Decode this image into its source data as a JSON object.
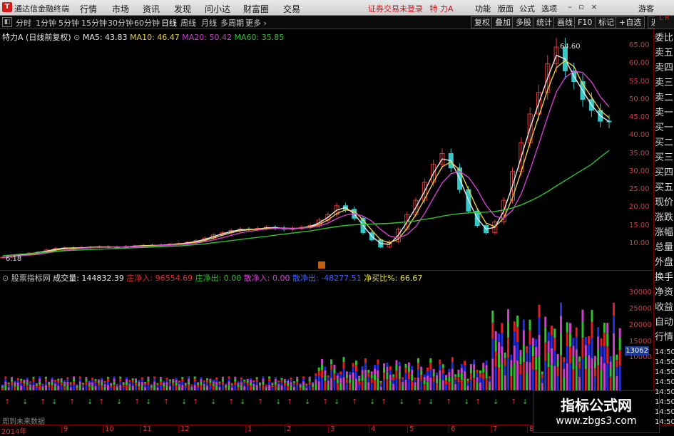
{
  "app": {
    "title": "通达信金融终端",
    "status": "证券交易未登录",
    "stock_short": "特 力A"
  },
  "menu": [
    "行情",
    "市场",
    "资讯",
    "发现",
    "问小达",
    "财富圈",
    "交易"
  ],
  "right_menu": [
    "功能",
    "版面",
    "公式",
    "选项",
    "游客"
  ],
  "periods": [
    "分时",
    "1分钟",
    "5分钟",
    "15分钟",
    "30分钟",
    "60分钟",
    "日线",
    "周线",
    "月线",
    "多周期",
    "更多"
  ],
  "active_period": "日线",
  "tool_buttons": [
    "复权",
    "叠加",
    "多股",
    "统计",
    "画线",
    "F10",
    "标记",
    "+自选",
    "返回"
  ],
  "chart_header": {
    "name": "特力A",
    "adjust": "(日线前复权)"
  },
  "ma_legend": [
    {
      "label": "MA5: 43.83",
      "color": "#e8e8e8"
    },
    {
      "label": "MA10: 46.47",
      "color": "#e8d040"
    },
    {
      "label": "MA20: 50.42",
      "color": "#d040d0"
    },
    {
      "label": "MA60: 35.85",
      "color": "#30c030"
    }
  ],
  "vol_legend": [
    {
      "label": "股票指标网",
      "color": "#c8c8c8"
    },
    {
      "label": "成交量: 144832.39",
      "color": "#e8e8e8"
    },
    {
      "label": "庄净入: 96554.69",
      "color": "#e03030"
    },
    {
      "label": "庄净出: 0.00",
      "color": "#30c030"
    },
    {
      "label": "散净入: 0.00",
      "color": "#d040d0"
    },
    {
      "label": "散净出: -48277.51",
      "color": "#4060ff"
    },
    {
      "label": "净买比%: 66.67",
      "color": "#e8e040"
    }
  ],
  "price_annotations": {
    "high": "64.60",
    "low": "6.18"
  },
  "price_axis": [
    "65.00",
    "60.00",
    "55.00",
    "50.00",
    "45.00",
    "40.00",
    "35.00",
    "30.00",
    "25.00",
    "20.00",
    "15.00",
    "10.00"
  ],
  "vol_axis": [
    "30000",
    "25000",
    "20000",
    "15000",
    "10000"
  ],
  "vol_marker": "13062",
  "side_tabs": [
    "委比",
    "卖五",
    "卖四",
    "卖三",
    "卖二",
    "卖一",
    "买一",
    "买二",
    "买三",
    "买四",
    "买五",
    "现价",
    "涨跌",
    "涨幅",
    "总量",
    "外盘",
    "换手",
    "净资",
    "收益",
    "自动",
    "行情"
  ],
  "side_times": [
    "14:50",
    "14:50",
    "14:50",
    "14:50",
    "14:50",
    "14:50",
    "14:50",
    "14:50"
  ],
  "footer": {
    "note": "周到未来数据",
    "year": "2014年"
  },
  "months": [
    "9",
    "10",
    "11",
    "12",
    "1",
    "2",
    "3",
    "4",
    "5",
    "6",
    "7",
    "8"
  ],
  "watermark": {
    "line1": "指标公式网",
    "line2": "www.zbgs3.com"
  },
  "chart_data": {
    "type": "line",
    "title": "特力A",
    "ylim": [
      5,
      66
    ],
    "close": [
      6.2,
      6.6,
      7.0,
      7.3,
      7.6,
      8.2,
      8.6,
      8.8,
      8.7,
      8.9,
      9.0,
      9.1,
      9.0,
      8.9,
      9.2,
      9.3,
      9.5,
      9.4,
      9.6,
      9.8,
      10.0,
      10.3,
      10.8,
      11.5,
      12.4,
      13.0,
      13.6,
      14.0,
      13.8,
      14.2,
      14.5,
      14.3,
      14.0,
      14.2,
      14.5,
      15.0,
      16.5,
      18.0,
      20.5,
      19.5,
      17.0,
      13.0,
      11.0,
      9.0,
      10.5,
      14.0,
      18.0,
      22.0,
      27.0,
      32.0,
      35.0,
      31.0,
      25.0,
      19.0,
      15.0,
      13.0,
      16.0,
      22.0,
      30.0,
      38.0,
      46.0,
      52.0,
      60.0,
      64.6,
      58.0,
      55.0,
      50.0,
      47.0,
      44.0,
      43.8
    ],
    "ma60": [
      6.6,
      6.8,
      7.0,
      7.2,
      7.4,
      7.6,
      7.8,
      8.0,
      8.1,
      8.2,
      8.3,
      8.4,
      8.5,
      8.6,
      8.7,
      8.8,
      8.9,
      9.0,
      9.1,
      9.2,
      9.3,
      9.5,
      9.7,
      9.9,
      10.2,
      10.5,
      10.8,
      11.1,
      11.4,
      11.7,
      12.0,
      12.3,
      12.6,
      12.9,
      13.2,
      13.5,
      13.9,
      14.3,
      14.7,
      15.0,
      15.2,
      15.3,
      15.4,
      15.5,
      15.6,
      15.8,
      16.0,
      16.3,
      16.7,
      17.1,
      17.6,
      18.0,
      18.3,
      18.5,
      18.6,
      18.7,
      18.9,
      19.3,
      19.9,
      20.7,
      21.8,
      23.0,
      24.4,
      26.0,
      27.5,
      29.0,
      30.5,
      32.0,
      34.0,
      35.85
    ]
  }
}
